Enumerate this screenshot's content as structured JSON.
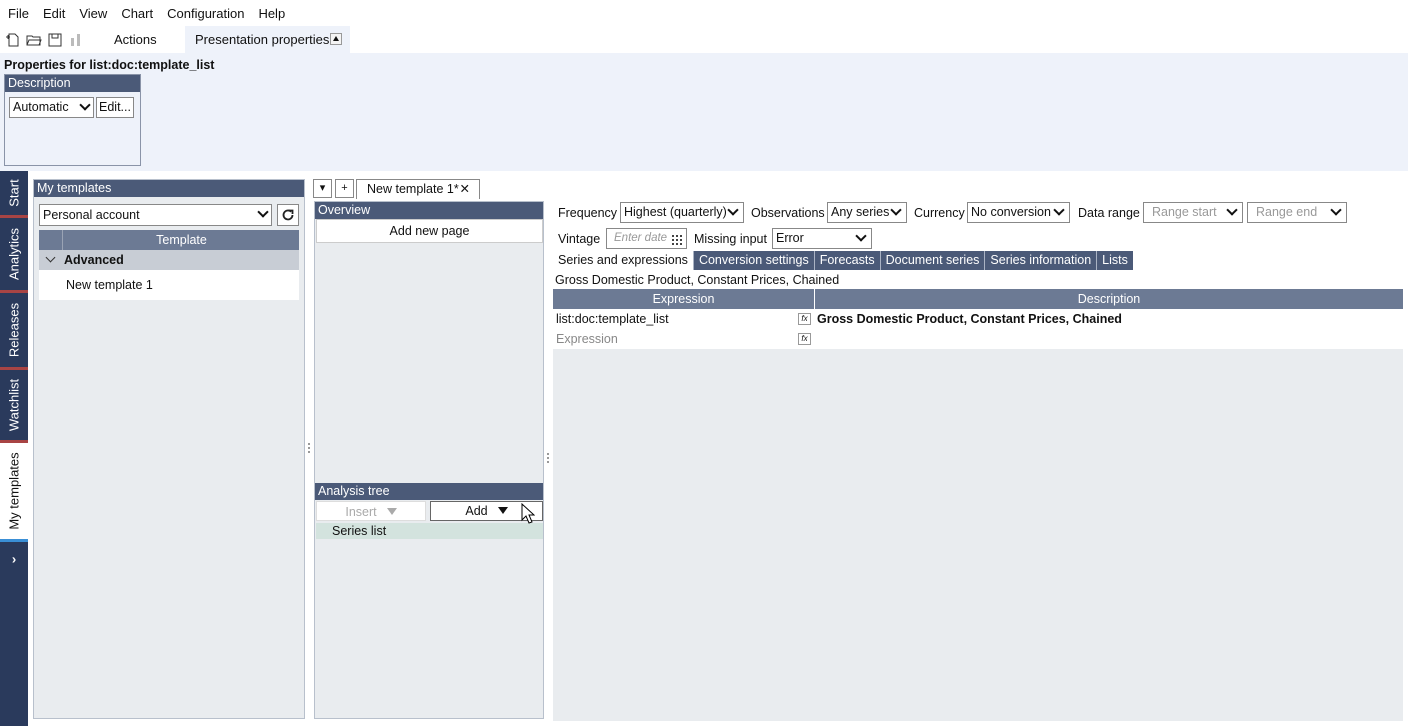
{
  "menu": [
    "File",
    "Edit",
    "View",
    "Chart",
    "Configuration",
    "Help"
  ],
  "toolbar": {
    "actions_label": "Actions",
    "presentation_tab": "Presentation properties"
  },
  "properties": {
    "title": "Properties for list:doc:template_list",
    "description_header": "Description",
    "description_value": "Automatic",
    "edit_label": "Edit..."
  },
  "rail": {
    "start": "Start",
    "analytics": "Analytics",
    "releases": "Releases",
    "watchlist": "Watchlist",
    "my_templates": "My templates",
    "expand": "›"
  },
  "my_templates": {
    "header": "My templates",
    "account": "Personal account",
    "column": "Template",
    "group": "Advanced",
    "item": "New template 1"
  },
  "doc_tabs": {
    "tab_label": "New template 1*",
    "close": "✕",
    "add": "+",
    "dropdown": "▾"
  },
  "overview": {
    "header": "Overview",
    "add_page": "Add new page"
  },
  "analysis_tree": {
    "header": "Analysis tree",
    "insert_label": "Insert",
    "add_label": "Add",
    "item": "Series list"
  },
  "settings": {
    "frequency_label": "Frequency",
    "frequency_value": "Highest (quarterly)",
    "observations_label": "Observations",
    "observations_value": "Any series",
    "currency_label": "Currency",
    "currency_value": "No conversion",
    "data_range_label": "Data range",
    "range_start": "Range start",
    "range_end": "Range end",
    "vintage_label": "Vintage",
    "vintage_placeholder": "Enter date",
    "missing_input_label": "Missing input",
    "missing_input_value": "Error"
  },
  "sub_tabs": [
    "Series and expressions",
    "Conversion settings",
    "Forecasts",
    "Document series",
    "Series information",
    "Lists"
  ],
  "series_title": "Gross Domestic Product, Constant Prices, Chained",
  "expression_table": {
    "headers": [
      "Expression",
      "Description"
    ],
    "rows": [
      {
        "expression": "list:doc:template_list",
        "description": "Gross Domestic Product, Constant Prices, Chained"
      },
      {
        "expression": "Expression",
        "description": ""
      }
    ]
  },
  "colors": {
    "panel_header": "#4b5a78",
    "rail": "#2a3a5c",
    "rail_accent": "#a84444",
    "properties_bg": "#eef2fa",
    "selected_row": "#d3e3de"
  }
}
